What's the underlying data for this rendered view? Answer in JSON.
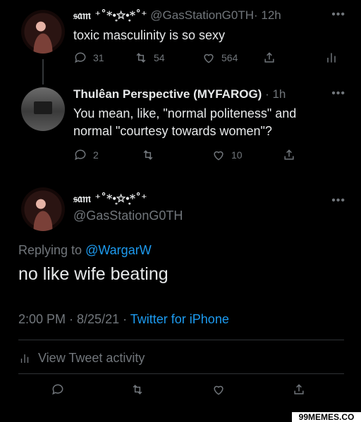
{
  "tweet1": {
    "display_name": "𝔰𝔞𝔪 ⁺˚*•̩̩͙✩•̩̩͙*˚⁺",
    "handle": "@GasStationG0TH",
    "time": "· 12h",
    "text": "toxic masculinity is so sexy",
    "replies": "31",
    "retweets": "54",
    "likes": "564"
  },
  "tweet2": {
    "display_name": "Thulêan Perspective (MYFAROG)",
    "time": "· 1h",
    "text_line1": "You mean, like, \"normal politeness\" and",
    "text_line2": "normal \"courtesy towards women\"?",
    "replies": "2",
    "retweets": "",
    "likes": "10"
  },
  "tweet3": {
    "display_name": "𝔰𝔞𝔪 ⁺˚*•̩̩͙✩•̩̩͙*˚⁺",
    "handle": "@GasStationG0TH",
    "replying_prefix": "Replying to",
    "replying_to": "@WargarW",
    "text": "no like wife beating",
    "timestamp": "2:00 PM · 8/25/21 ·",
    "source": "Twitter for iPhone",
    "activity": "View Tweet activity"
  },
  "watermark": "99MEMES.CO",
  "more_glyph": "•••",
  "icons": [
    "reply-icon",
    "retweet-icon",
    "like-icon",
    "share-icon",
    "analytics-icon"
  ]
}
